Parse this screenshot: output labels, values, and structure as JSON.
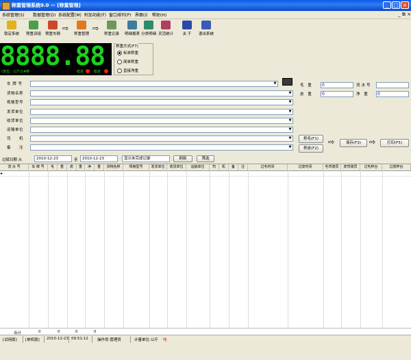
{
  "window": {
    "title": "称重管理系统9.0 － [称重管理]",
    "buttons": [
      "_",
      "□",
      "×"
    ]
  },
  "menu": [
    "系统管理(S)",
    "数据管理(D)",
    "系统配置(M)",
    "附加功能(F)",
    "窗口排列(P)",
    "界面(I)",
    "帮助(H)"
  ],
  "mdi_controls": "_ ⧉ ×",
  "toolbar": {
    "items": [
      "锁定系统",
      "预置词组",
      "预置车辆",
      "称重管理",
      "称重记录",
      "明细报表",
      "分类明细",
      "灵活统计",
      "关 于",
      "退出系统"
    ],
    "arrow": "⇨"
  },
  "display": {
    "value": "8888.88",
    "unit": "(单位：公斤)1#称",
    "stable": "稳定",
    "done": "稳定"
  },
  "mode": {
    "legend": "称重方式(F7)",
    "options": [
      "标准称重",
      "简单称重",
      "直接净重"
    ],
    "selected": 0
  },
  "fields": [
    {
      "label": "车 牌 号",
      "value": ""
    },
    {
      "label": "货物名称",
      "value": ""
    },
    {
      "label": "规格型号",
      "value": ""
    },
    {
      "label": "发货单位",
      "value": ""
    },
    {
      "label": "收货单位",
      "value": ""
    },
    {
      "label": "运输单位",
      "value": ""
    },
    {
      "label": "司　　机",
      "value": ""
    },
    {
      "label": "备　　注",
      "value": ""
    }
  ],
  "weights": {
    "gross_label": "毛 重",
    "gross": "0",
    "serial_label": "流水号",
    "serial": "",
    "tare_label": "皮 重",
    "tare": "0",
    "net_label": "净 重",
    "net": "0"
  },
  "actions": {
    "gross_btn": "称毛(F1)",
    "tare_btn": "称皮(F2)",
    "save_btn": "保存(F3)",
    "print_btn": "打印(F5)"
  },
  "filter": {
    "label": "过磅日期 从",
    "from": "2010-12-23",
    "to_label": "至",
    "to": "2010-12-23",
    "show": "显示未完成记录",
    "refresh": "刷新",
    "filter_btn": "筛选"
  },
  "table": {
    "columns": [
      "流 水 号",
      "车 牌 号",
      "毛",
      "重",
      "皮",
      "重",
      "净",
      "重",
      "货物名称",
      "规格型号",
      "发货单位",
      "收货单位",
      "运输单位",
      "司",
      "机",
      "备",
      "注",
      "过毛时间",
      "过皮时间",
      "毛司磅员",
      "皮司磅员",
      "过毛秤台",
      "过皮秤台"
    ],
    "totals": [
      "合计",
      "0",
      "0",
      "0",
      "0"
    ]
  },
  "status": {
    "trial": "[试用版]",
    "edition": "[单机版]",
    "date": "2010-12-23",
    "time": "09:51:12",
    "operator": "操作员:管理员",
    "unit": "计量单位:公斤",
    "flag": "吨"
  }
}
